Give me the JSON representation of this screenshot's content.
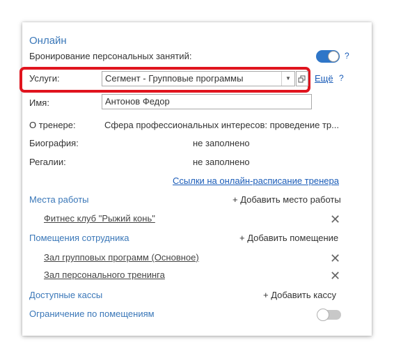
{
  "online": {
    "title": "Онлайн",
    "personal_booking_label": "Бронирование персональных занятий:",
    "help": "?"
  },
  "services": {
    "label": "Услуги:",
    "value": "Сегмент - Групповые программы",
    "more_link": "Ещё",
    "help": "?"
  },
  "name": {
    "label": "Имя:",
    "value": "Антонов Федор"
  },
  "about": {
    "label": "О тренере:",
    "value": "Сфера профессиональных интересов: проведение тр..."
  },
  "biography": {
    "label": "Биография:",
    "value": "не заполнено"
  },
  "regalia": {
    "label": "Регалии:",
    "value": "не заполнено"
  },
  "trainer_schedule_link": "Ссылки на онлайн-расписание тренера",
  "workplaces": {
    "title": "Места работы",
    "add_label": "+ Добавить место работы",
    "items": [
      "Фитнес клуб \"Рыжий конь\""
    ]
  },
  "rooms": {
    "title": "Помещения сотрудника",
    "add_label": "+ Добавить помещение",
    "items": [
      "Зал групповых программ (Основное)",
      "Зал персонального тренинга"
    ]
  },
  "cashboxes": {
    "title": "Доступные кассы",
    "add_label": "+ Добавить кассу"
  },
  "room_restriction": {
    "title": "Ограничение по помещениям"
  },
  "icons": {
    "dropdown": "chevron-down-icon",
    "open": "open-window-icon",
    "remove": "close-icon"
  }
}
